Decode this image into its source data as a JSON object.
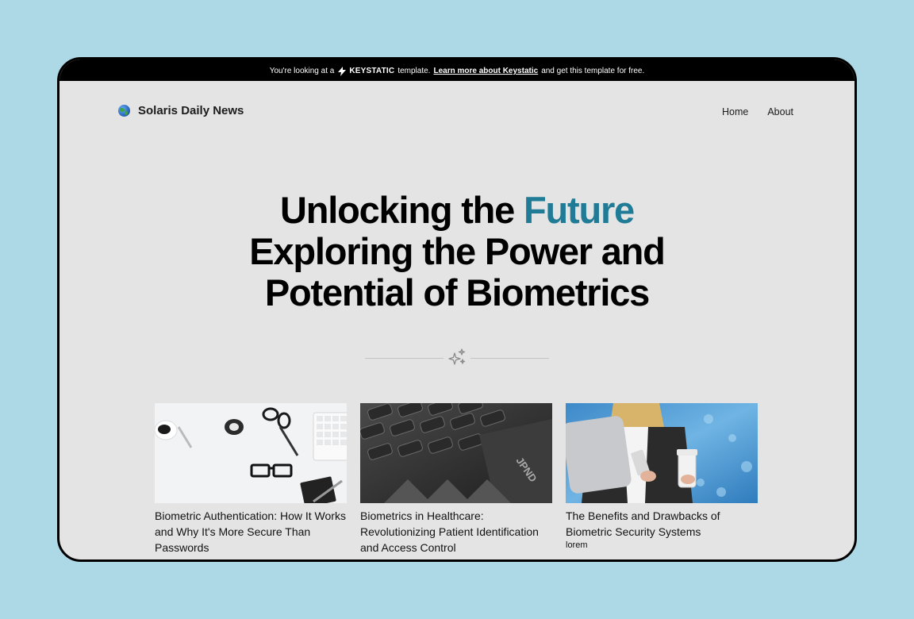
{
  "banner": {
    "prefix": "You're looking at a",
    "brand": "KEYSTATIC",
    "middle": "template.",
    "link": "Learn more about Keystatic",
    "suffix": "and get this template for free."
  },
  "header": {
    "logo_icon": "globe-icon",
    "site_title": "Solaris Daily News",
    "nav": [
      "Home",
      "About"
    ]
  },
  "hero": {
    "line1_pre": "Unlocking the",
    "line1_accent": "Future",
    "line2": "Exploring the Power and",
    "line3": "Potential of Biometrics"
  },
  "divider": {
    "icon": "sparkles-icon"
  },
  "articles": [
    {
      "title": "Biometric Authentication: How It Works and Why It's More Secure Than Passwords",
      "meta": ""
    },
    {
      "title": "Biometrics in Healthcare: Revolutionizing Patient Identification and Access Control",
      "meta": ""
    },
    {
      "title": "The Benefits and Drawbacks of Biometric Security Systems",
      "meta": "lorem"
    }
  ],
  "colors": {
    "accent": "#1f7b96",
    "page_bg": "#add8e6",
    "content_bg": "#e4e4e4",
    "banner_bg": "#000000"
  }
}
